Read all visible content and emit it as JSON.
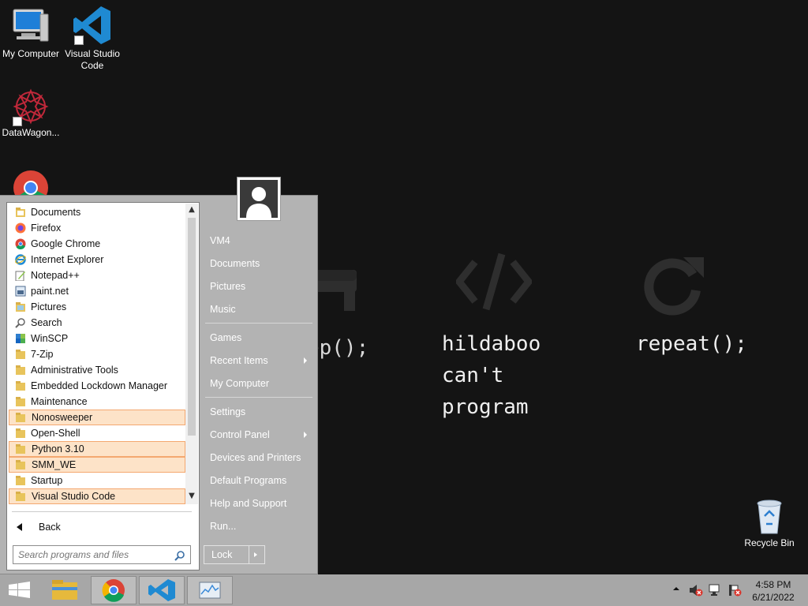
{
  "desktop": {
    "icons": [
      {
        "label": "My Computer",
        "icon": "computer-icon"
      },
      {
        "label": "Visual Studio Code",
        "icon": "vscode-icon"
      },
      {
        "label": "DataWagon...",
        "icon": "datawagon-icon"
      },
      {
        "label": "",
        "icon": "chrome-icon"
      },
      {
        "label": "Recycle Bin",
        "icon": "recycle-bin-icon"
      }
    ]
  },
  "wallpaper": {
    "sleep": "sleep();",
    "hildaboo": "hildaboo\ncan't\nprogram",
    "repeat": "repeat();"
  },
  "start_menu": {
    "programs": [
      {
        "label": "Documents",
        "icon": "folder-icon",
        "highlighted": false
      },
      {
        "label": "Firefox",
        "icon": "firefox-icon",
        "highlighted": false
      },
      {
        "label": "Google Chrome",
        "icon": "chrome-icon",
        "highlighted": false
      },
      {
        "label": "Internet Explorer",
        "icon": "ie-icon",
        "highlighted": false
      },
      {
        "label": "Notepad++",
        "icon": "notepadpp-icon",
        "highlighted": false
      },
      {
        "label": "paint.net",
        "icon": "paintnet-icon",
        "highlighted": false
      },
      {
        "label": "Pictures",
        "icon": "folder-icon",
        "highlighted": false
      },
      {
        "label": "Search",
        "icon": "search-icon",
        "highlighted": false
      },
      {
        "label": "WinSCP",
        "icon": "winscp-icon",
        "highlighted": false
      },
      {
        "label": "7-Zip",
        "icon": "folder-icon",
        "highlighted": false
      },
      {
        "label": "Administrative Tools",
        "icon": "folder-icon",
        "highlighted": false
      },
      {
        "label": "Embedded Lockdown Manager",
        "icon": "folder-icon",
        "highlighted": false
      },
      {
        "label": "Maintenance",
        "icon": "folder-icon",
        "highlighted": false
      },
      {
        "label": "Nonosweeper",
        "icon": "folder-icon",
        "highlighted": true
      },
      {
        "label": "Open-Shell",
        "icon": "folder-icon",
        "highlighted": false
      },
      {
        "label": "Python 3.10",
        "icon": "folder-icon",
        "highlighted": true
      },
      {
        "label": "SMM_WE",
        "icon": "folder-icon",
        "highlighted": true
      },
      {
        "label": "Startup",
        "icon": "folder-icon",
        "highlighted": false
      },
      {
        "label": "Visual Studio Code",
        "icon": "folder-icon",
        "highlighted": true
      }
    ],
    "back_label": "Back",
    "search_placeholder": "Search programs and files",
    "right_items": [
      {
        "label": "VM4",
        "submenu": false
      },
      {
        "label": "Documents",
        "submenu": false
      },
      {
        "label": "Pictures",
        "submenu": false
      },
      {
        "label": "Music",
        "submenu": false
      },
      {
        "label": "Games",
        "submenu": false
      },
      {
        "label": "Recent Items",
        "submenu": true
      },
      {
        "label": "My Computer",
        "submenu": false
      },
      {
        "label": "Settings",
        "submenu": false
      },
      {
        "label": "Control Panel",
        "submenu": true
      },
      {
        "label": "Devices and Printers",
        "submenu": false
      },
      {
        "label": "Default Programs",
        "submenu": false
      },
      {
        "label": "Help and Support",
        "submenu": false
      },
      {
        "label": "Run...",
        "submenu": false
      }
    ],
    "lock_label": "Lock"
  },
  "taskbar": {
    "pinned": [
      "start-icon",
      "file-explorer-icon",
      "chrome-icon",
      "vscode-icon",
      "task-manager-icon"
    ],
    "tray": [
      "show-hidden-icons-icon",
      "volume-muted-icon",
      "network-icon",
      "action-center-icon"
    ],
    "time": "4:58 PM",
    "date": "6/21/2022"
  },
  "colors": {
    "desktop_bg": "#141414",
    "start_menu_bg": "#b3b3b3",
    "highlight_bg": "#fde3c8",
    "highlight_border": "#f4a870",
    "taskbar_bg": "#a7a7a7"
  }
}
